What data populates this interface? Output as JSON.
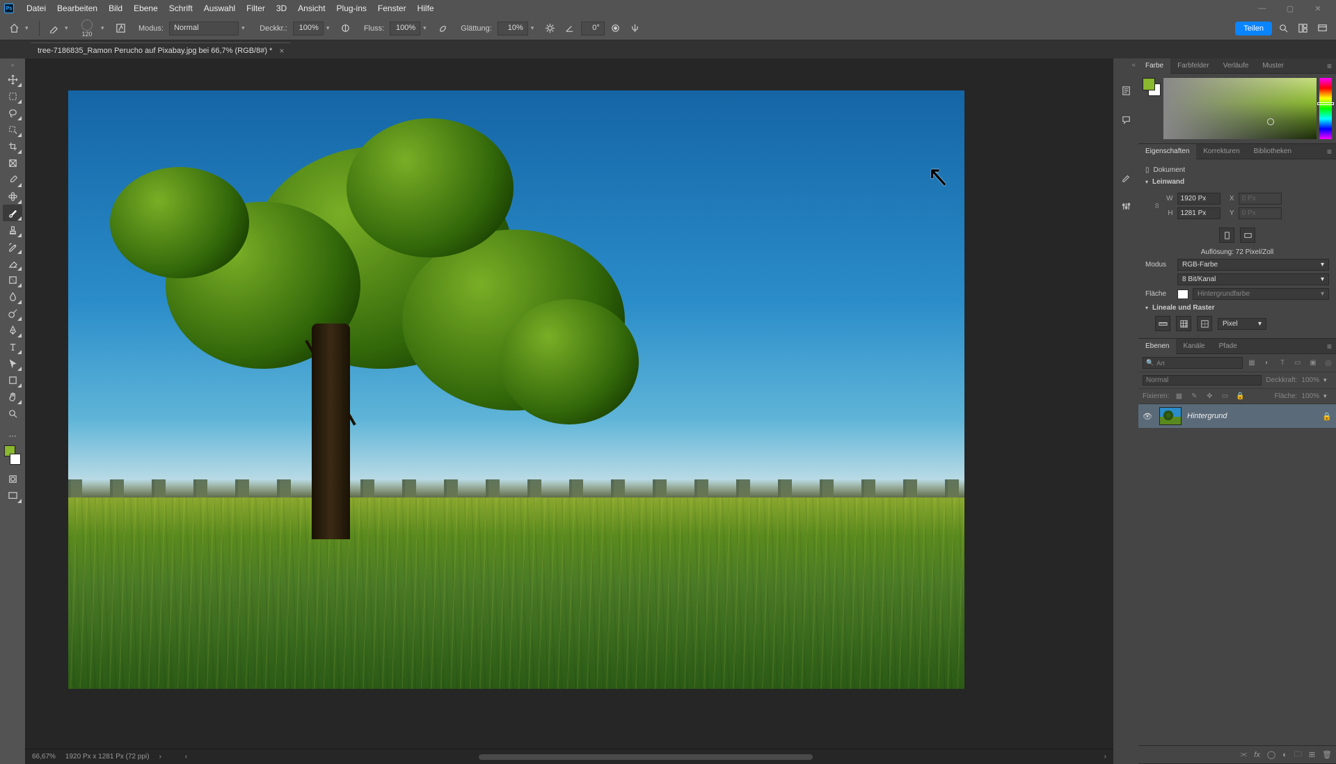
{
  "menubar": {
    "items": [
      "Datei",
      "Bearbeiten",
      "Bild",
      "Ebene",
      "Schrift",
      "Auswahl",
      "Filter",
      "3D",
      "Ansicht",
      "Plug-ins",
      "Fenster",
      "Hilfe"
    ]
  },
  "optbar": {
    "brush_size": "120",
    "mode_label": "Modus:",
    "mode_value": "Normal",
    "opacity_label": "Deckkr.:",
    "opacity_value": "100%",
    "flow_label": "Fluss:",
    "flow_value": "100%",
    "smoothing_label": "Glättung:",
    "smoothing_value": "10%",
    "angle_value": "0°",
    "share": "Teilen"
  },
  "doc_tab": {
    "title": "tree-7186835_Ramon Perucho auf Pixabay.jpg bei 66,7% (RGB/8#) *"
  },
  "panels": {
    "color": {
      "tabs": [
        "Farbe",
        "Farbfelder",
        "Verläufe",
        "Muster"
      ]
    },
    "properties": {
      "tabs": [
        "Eigenschaften",
        "Korrekturen",
        "Bibliotheken"
      ],
      "doc_label": "Dokument",
      "canvas_section": "Leinwand",
      "width_label": "W",
      "width_value": "1920 Px",
      "height_label": "H",
      "height_value": "1281 Px",
      "x_label": "X",
      "y_label": "Y",
      "xy_placeholder": "0 Px",
      "resolution": "Auflösung: 72 Pixel/Zoll",
      "mode_label": "Modus",
      "mode_value": "RGB-Farbe",
      "depth_value": "8 Bit/Kanal",
      "fill_label": "Fläche",
      "fill_value": "Hintergrundfarbe",
      "rulers_section": "Lineale und Raster",
      "rulers_unit": "Pixel"
    },
    "layers": {
      "tabs": [
        "Ebenen",
        "Kanäle",
        "Pfade"
      ],
      "search_placeholder": "Art",
      "blend_value": "Normal",
      "opacity_label": "Deckkraft:",
      "opacity_value": "100%",
      "lock_label": "Fixieren:",
      "fill_label": "Fläche:",
      "fill_value": "100%",
      "layer_name": "Hintergrund"
    }
  },
  "statusbar": {
    "zoom": "66,67%",
    "dims": "1920 Px x 1281 Px (72 ppi)"
  }
}
